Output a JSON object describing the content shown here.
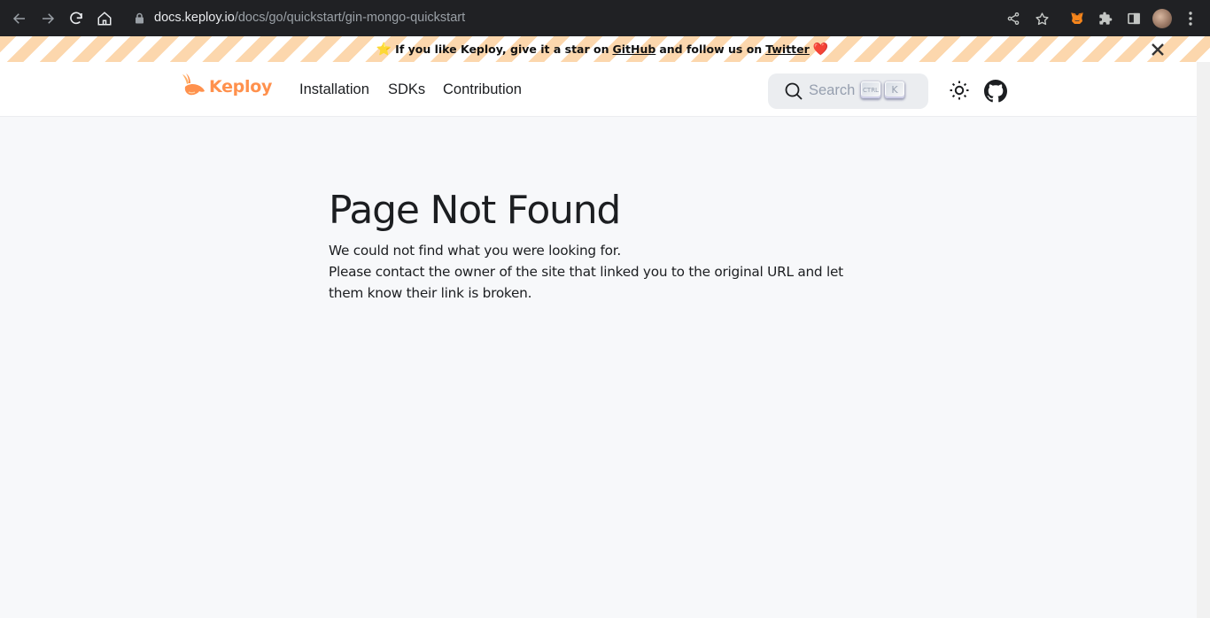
{
  "browser": {
    "url_host": "docs.keploy.io",
    "url_path": "/docs/go/quickstart/gin-mongo-quickstart"
  },
  "banner": {
    "text_before": "If you like Keploy, give it a star on",
    "github_link": "GitHub",
    "text_middle": "and follow us on",
    "twitter_link": "Twitter",
    "star_glyph": "⭐",
    "heart_glyph": "❤️"
  },
  "navbar": {
    "logo_text": "Keploy",
    "links": [
      "Installation",
      "SDKs",
      "Contribution"
    ],
    "search_placeholder": "Search",
    "kbd_ctrl": "CTRL",
    "kbd_k": "K"
  },
  "main": {
    "title": "Page Not Found",
    "line1": "We could not find what you were looking for.",
    "line2": "Please contact the owner of the site that linked you to the original URL and let them know their link is broken."
  },
  "colors": {
    "brand_orange": "#ff914d",
    "banner_stripe": "#fcd7ad",
    "chrome_bg": "#202124"
  }
}
